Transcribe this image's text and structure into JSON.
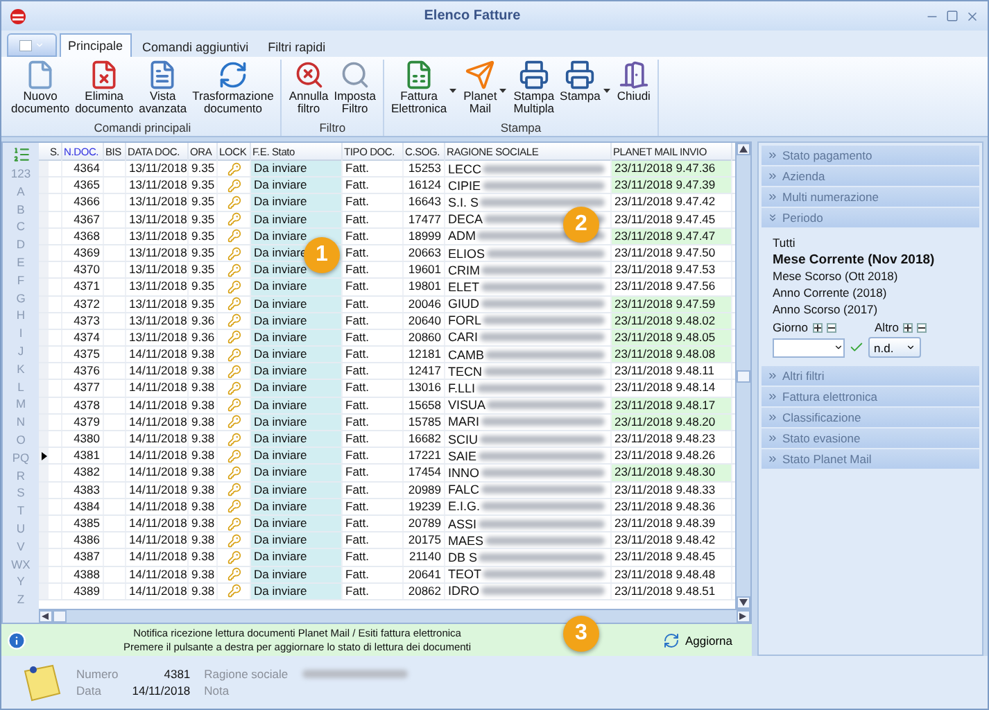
{
  "window": {
    "title": "Elenco Fatture"
  },
  "tabs": [
    {
      "label": "Principale",
      "selected": true
    },
    {
      "label": "Comandi aggiuntivi",
      "selected": false
    },
    {
      "label": "Filtri rapidi",
      "selected": false
    }
  ],
  "ribbon_groups": [
    {
      "title": "Comandi principali",
      "buttons": [
        {
          "kind": "new",
          "label": "Nuovo\ndocumento",
          "has_menu": false
        },
        {
          "kind": "delete",
          "label": "Elimina\ndocumento",
          "has_menu": false
        },
        {
          "kind": "view",
          "label": "Vista\navanzata",
          "has_menu": false
        },
        {
          "kind": "transform",
          "label": "Trasformazione\ndocumento",
          "has_menu": false
        }
      ]
    },
    {
      "title": "Filtro",
      "buttons": [
        {
          "kind": "clear_filter",
          "label": "Annulla\nfiltro",
          "has_menu": false
        },
        {
          "kind": "filter",
          "label": "Imposta\nFiltro",
          "has_menu": false
        }
      ]
    },
    {
      "title": "Stampa",
      "buttons": [
        {
          "kind": "invoice",
          "label": "Fattura\nElettronica",
          "has_menu": true
        },
        {
          "kind": "mail",
          "label": "Planet\nMail",
          "has_menu": true
        },
        {
          "kind": "print",
          "label": "Stampa\nMultipla",
          "has_menu": false
        },
        {
          "kind": "print",
          "label": "Stampa",
          "has_menu": true
        },
        {
          "kind": "exit",
          "label": "Chiudi",
          "has_menu": false
        }
      ]
    }
  ],
  "index_letters": [
    "123",
    "A",
    "B",
    "C",
    "D",
    "E",
    "F",
    "G",
    "H",
    "I",
    "J",
    "K",
    "L",
    "M",
    "N",
    "O",
    "PQ",
    "R",
    "S",
    "T",
    "U",
    "V",
    "WX",
    "Y",
    "Z"
  ],
  "table": {
    "columns": [
      "S.",
      "N.DOC.",
      "BIS",
      "DATA DOC.",
      "ORA",
      "LOCK",
      "F.E. Stato",
      "TIPO DOC.",
      "C.SOG.",
      "RAGIONE SOCIALE",
      "PLANET MAIL INVIO"
    ],
    "rows": [
      {
        "n": "4364",
        "date": "13/11/2018",
        "time": "9.35",
        "state": "Da inviare",
        "type": "Fatt.",
        "csog": "15253",
        "name": "LECC",
        "sent": "23/11/2018 9.47.36",
        "read": true,
        "selected": false
      },
      {
        "n": "4365",
        "date": "13/11/2018",
        "time": "9.35",
        "state": "Da inviare",
        "type": "Fatt.",
        "csog": "16124",
        "name": "CIPIE",
        "sent": "23/11/2018 9.47.39",
        "read": true,
        "selected": false
      },
      {
        "n": "4366",
        "date": "13/11/2018",
        "time": "9.35",
        "state": "Da inviare",
        "type": "Fatt.",
        "csog": "16643",
        "name": "S.I. S",
        "sent": "23/11/2018 9.47.42",
        "read": false,
        "selected": false
      },
      {
        "n": "4367",
        "date": "13/11/2018",
        "time": "9.35",
        "state": "Da inviare",
        "type": "Fatt.",
        "csog": "17477",
        "name": "DECA",
        "sent": "23/11/2018 9.47.45",
        "read": false,
        "selected": false
      },
      {
        "n": "4368",
        "date": "13/11/2018",
        "time": "9.35",
        "state": "Da inviare",
        "type": "Fatt.",
        "csog": "18999",
        "name": "ADM",
        "sent": "23/11/2018 9.47.47",
        "read": true,
        "selected": false
      },
      {
        "n": "4369",
        "date": "13/11/2018",
        "time": "9.35",
        "state": "Da inviare",
        "type": "Fatt.",
        "csog": "20663",
        "name": "ELIOS",
        "sent": "23/11/2018 9.47.50",
        "read": false,
        "selected": false
      },
      {
        "n": "4370",
        "date": "13/11/2018",
        "time": "9.35",
        "state": "Da inviare",
        "type": "Fatt.",
        "csog": "19601",
        "name": "CRIM",
        "sent": "23/11/2018 9.47.53",
        "read": false,
        "selected": false
      },
      {
        "n": "4371",
        "date": "13/11/2018",
        "time": "9.35",
        "state": "Da inviare",
        "type": "Fatt.",
        "csog": "19801",
        "name": "ELET",
        "sent": "23/11/2018 9.47.56",
        "read": false,
        "selected": false
      },
      {
        "n": "4372",
        "date": "13/11/2018",
        "time": "9.35",
        "state": "Da inviare",
        "type": "Fatt.",
        "csog": "20046",
        "name": "GIUD",
        "sent": "23/11/2018 9.47.59",
        "read": true,
        "selected": false
      },
      {
        "n": "4373",
        "date": "13/11/2018",
        "time": "9.36",
        "state": "Da inviare",
        "type": "Fatt.",
        "csog": "20640",
        "name": "FORL",
        "sent": "23/11/2018 9.48.02",
        "read": true,
        "selected": false
      },
      {
        "n": "4374",
        "date": "13/11/2018",
        "time": "9.36",
        "state": "Da inviare",
        "type": "Fatt.",
        "csog": "20860",
        "name": "CARI",
        "sent": "23/11/2018 9.48.05",
        "read": true,
        "selected": false
      },
      {
        "n": "4375",
        "date": "14/11/2018",
        "time": "9.38",
        "state": "Da inviare",
        "type": "Fatt.",
        "csog": "12181",
        "name": "CAMB",
        "sent": "23/11/2018 9.48.08",
        "read": true,
        "selected": false
      },
      {
        "n": "4376",
        "date": "14/11/2018",
        "time": "9.38",
        "state": "Da inviare",
        "type": "Fatt.",
        "csog": "12417",
        "name": "TECN",
        "sent": "23/11/2018 9.48.11",
        "read": false,
        "selected": false
      },
      {
        "n": "4377",
        "date": "14/11/2018",
        "time": "9.38",
        "state": "Da inviare",
        "type": "Fatt.",
        "csog": "13016",
        "name": "F.LLI",
        "sent": "23/11/2018 9.48.14",
        "read": false,
        "selected": false
      },
      {
        "n": "4378",
        "date": "14/11/2018",
        "time": "9.38",
        "state": "Da inviare",
        "type": "Fatt.",
        "csog": "15658",
        "name": "VISUA",
        "sent": "23/11/2018 9.48.17",
        "read": true,
        "selected": false
      },
      {
        "n": "4379",
        "date": "14/11/2018",
        "time": "9.38",
        "state": "Da inviare",
        "type": "Fatt.",
        "csog": "15785",
        "name": "MARI",
        "sent": "23/11/2018 9.48.20",
        "read": true,
        "selected": false
      },
      {
        "n": "4380",
        "date": "14/11/2018",
        "time": "9.38",
        "state": "Da inviare",
        "type": "Fatt.",
        "csog": "16682",
        "name": "SCIU",
        "sent": "23/11/2018 9.48.23",
        "read": false,
        "selected": false
      },
      {
        "n": "4381",
        "date": "14/11/2018",
        "time": "9.38",
        "state": "Da inviare",
        "type": "Fatt.",
        "csog": "17221",
        "name": "SAIE",
        "sent": "23/11/2018 9.48.26",
        "read": false,
        "selected": true
      },
      {
        "n": "4382",
        "date": "14/11/2018",
        "time": "9.38",
        "state": "Da inviare",
        "type": "Fatt.",
        "csog": "17454",
        "name": "INNO",
        "sent": "23/11/2018 9.48.30",
        "read": true,
        "selected": false
      },
      {
        "n": "4383",
        "date": "14/11/2018",
        "time": "9.38",
        "state": "Da inviare",
        "type": "Fatt.",
        "csog": "20989",
        "name": "FALC",
        "sent": "23/11/2018 9.48.33",
        "read": false,
        "selected": false
      },
      {
        "n": "4384",
        "date": "14/11/2018",
        "time": "9.38",
        "state": "Da inviare",
        "type": "Fatt.",
        "csog": "19239",
        "name": "E.I.G.",
        "sent": "23/11/2018 9.48.36",
        "read": false,
        "selected": false
      },
      {
        "n": "4385",
        "date": "14/11/2018",
        "time": "9.38",
        "state": "Da inviare",
        "type": "Fatt.",
        "csog": "20789",
        "name": "ASSI",
        "sent": "23/11/2018 9.48.39",
        "read": false,
        "selected": false
      },
      {
        "n": "4386",
        "date": "14/11/2018",
        "time": "9.38",
        "state": "Da inviare",
        "type": "Fatt.",
        "csog": "20175",
        "name": "MAES",
        "sent": "23/11/2018 9.48.42",
        "read": false,
        "selected": false
      },
      {
        "n": "4387",
        "date": "14/11/2018",
        "time": "9.38",
        "state": "Da inviare",
        "type": "Fatt.",
        "csog": "21140",
        "name": "DB S",
        "sent": "23/11/2018 9.48.45",
        "read": false,
        "selected": false
      },
      {
        "n": "4388",
        "date": "14/11/2018",
        "time": "9.38",
        "state": "Da inviare",
        "type": "Fatt.",
        "csog": "20641",
        "name": "TEOT",
        "sent": "23/11/2018 9.48.48",
        "read": false,
        "selected": false
      },
      {
        "n": "4389",
        "date": "14/11/2018",
        "time": "9.38",
        "state": "Da inviare",
        "type": "Fatt.",
        "csog": "20862",
        "name": "IDRO",
        "sent": "23/11/2018 9.48.51",
        "read": false,
        "selected": false
      }
    ]
  },
  "notice": {
    "lines": [
      "Notifica ricezione lettura documenti Planet Mail / Esiti fattura elettronica",
      "Premere il pulsante a destra per aggiornare lo stato di lettura dei documenti"
    ],
    "button": "Aggiorna"
  },
  "markers": [
    "1",
    "2",
    "3"
  ],
  "filter_panel": {
    "sections": [
      {
        "title": "Stato pagamento",
        "expanded": false
      },
      {
        "title": "Azienda",
        "expanded": false
      },
      {
        "title": "Multi numerazione",
        "expanded": false
      },
      {
        "title": "Periodo",
        "expanded": true,
        "options": [
          {
            "label": "Tutti",
            "selected": false
          },
          {
            "label": "Mese Corrente (Nov 2018)",
            "selected": true
          },
          {
            "label": "Mese Scorso (Ott 2018)",
            "selected": false
          },
          {
            "label": "Anno Corrente (2018)",
            "selected": false
          },
          {
            "label": "Anno Scorso (2017)",
            "selected": false
          }
        ],
        "day_label": "Giorno",
        "other_label": "Altro",
        "other_value": "n.d."
      },
      {
        "title": "Altri filtri",
        "expanded": false
      },
      {
        "title": "Fattura elettronica",
        "expanded": false
      },
      {
        "title": "Classificazione",
        "expanded": false
      },
      {
        "title": "Stato evasione",
        "expanded": false
      },
      {
        "title": "Stato Planet Mail",
        "expanded": false
      }
    ]
  },
  "details": {
    "number_label": "Numero",
    "number": "4381",
    "date_label": "Data",
    "date": "14/11/2018",
    "name_label": "Ragione sociale",
    "note_label": "Nota"
  }
}
